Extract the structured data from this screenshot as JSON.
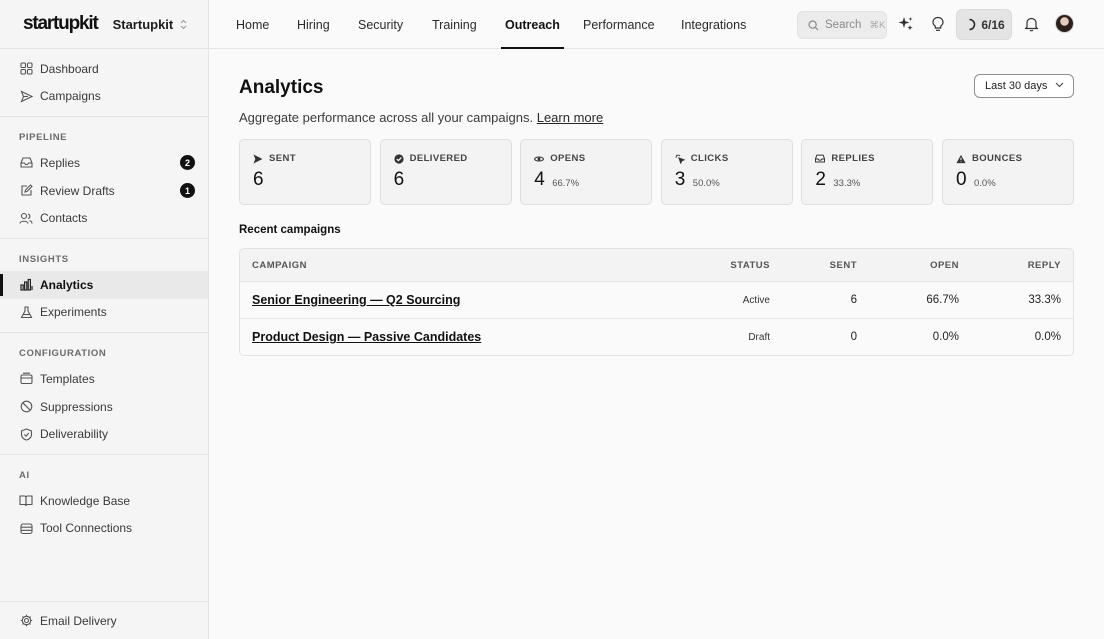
{
  "brand": {
    "logo": "startupkit",
    "org": "Startupkit"
  },
  "sidebar": {
    "top_items": [
      {
        "label": "Dashboard",
        "icon": "grid-icon"
      },
      {
        "label": "Campaigns",
        "icon": "send-icon"
      }
    ],
    "groups": [
      {
        "title": "PIPELINE",
        "items": [
          {
            "label": "Replies",
            "icon": "inbox-icon",
            "badge": "2"
          },
          {
            "label": "Review Drafts",
            "icon": "edit-icon",
            "badge": "1"
          },
          {
            "label": "Contacts",
            "icon": "users-icon"
          }
        ]
      },
      {
        "title": "INSIGHTS",
        "items": [
          {
            "label": "Analytics",
            "icon": "bar-chart-icon",
            "active": true
          },
          {
            "label": "Experiments",
            "icon": "flask-icon"
          }
        ]
      },
      {
        "title": "CONFIGURATION",
        "items": [
          {
            "label": "Templates",
            "icon": "template-icon"
          },
          {
            "label": "Suppressions",
            "icon": "ban-icon"
          },
          {
            "label": "Deliverability",
            "icon": "shield-check-icon"
          }
        ]
      },
      {
        "title": "AI",
        "items": [
          {
            "label": "Knowledge Base",
            "icon": "book-icon"
          },
          {
            "label": "Tool Connections",
            "icon": "database-icon"
          }
        ]
      }
    ],
    "footer": {
      "label": "Email Delivery",
      "icon": "gear-icon"
    }
  },
  "topnav": {
    "tabs": [
      "Home",
      "Hiring",
      "Security",
      "Training",
      "Outreach",
      "Performance",
      "Integrations"
    ],
    "active_tab": "Outreach",
    "search": {
      "placeholder": "Search",
      "shortcut": "⌘K"
    },
    "progress": "6/16"
  },
  "page": {
    "title": "Analytics",
    "subtitle": "Aggregate performance across all your campaigns.",
    "learn_more": "Learn more",
    "date_range": "Last 30 days"
  },
  "metrics": [
    {
      "label": "SENT",
      "value": "6",
      "pct": "",
      "icon": "send-icon"
    },
    {
      "label": "DELIVERED",
      "value": "6",
      "pct": "",
      "icon": "check-circle-icon"
    },
    {
      "label": "OPENS",
      "value": "4",
      "pct": "66.7%",
      "icon": "eye-icon"
    },
    {
      "label": "CLICKS",
      "value": "3",
      "pct": "50.0%",
      "icon": "pointer-icon"
    },
    {
      "label": "REPLIES",
      "value": "2",
      "pct": "33.3%",
      "icon": "inbox-icon"
    },
    {
      "label": "BOUNCES",
      "value": "0",
      "pct": "0.0%",
      "icon": "warning-icon"
    }
  ],
  "recent": {
    "title": "Recent campaigns",
    "columns": [
      "CAMPAIGN",
      "STATUS",
      "SENT",
      "OPEN",
      "REPLY"
    ],
    "rows": [
      {
        "campaign": "Senior Engineering — Q2 Sourcing",
        "status": "Active",
        "sent": "6",
        "open": "66.7%",
        "reply": "33.3%"
      },
      {
        "campaign": "Product Design — Passive Candidates",
        "status": "Draft",
        "sent": "0",
        "open": "0.0%",
        "reply": "0.0%"
      }
    ]
  }
}
